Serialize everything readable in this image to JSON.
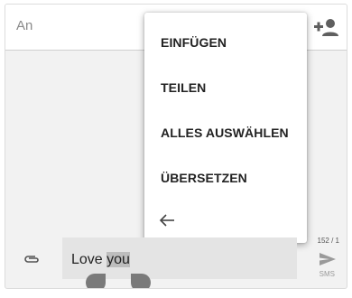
{
  "to_bar": {
    "label": "An",
    "add_contact_icon": "person-add-icon"
  },
  "context_menu": {
    "items": [
      {
        "label": "EINFÜGEN"
      },
      {
        "label": "TEILEN"
      },
      {
        "label": "ALLES AUSWÄHLEN"
      },
      {
        "label": "ÜBERSETZEN"
      }
    ],
    "back_icon": "arrow-left-icon"
  },
  "compose": {
    "attach_icon": "paperclip-icon",
    "text_before": "Love ",
    "selected_text": "you",
    "char_counter": "152 / 1",
    "send_icon": "send-icon",
    "send_label": "SMS"
  },
  "colors": {
    "background": "#f2f2f2",
    "menu_background": "#ffffff",
    "selection": "#bdbdbd",
    "handle": "#7a7a7a"
  }
}
